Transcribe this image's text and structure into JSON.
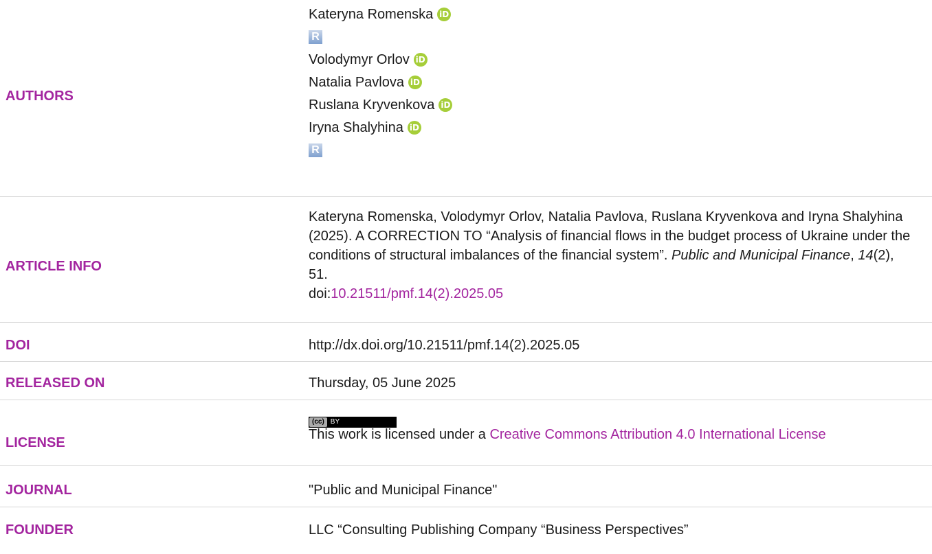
{
  "authors": {
    "label": "AUTHORS",
    "list": [
      {
        "name": "Kateryna Romenska",
        "orcid": true,
        "researchgate": true
      },
      {
        "name": "Volodymyr Orlov",
        "orcid": true,
        "researchgate": false
      },
      {
        "name": "Natalia Pavlova",
        "orcid": true,
        "researchgate": false
      },
      {
        "name": "Ruslana Kryvenkova",
        "orcid": true,
        "researchgate": false
      },
      {
        "name": "Iryna Shalyhina",
        "orcid": true,
        "researchgate": true
      }
    ],
    "orcid_text": "iD",
    "rg_text": "R"
  },
  "article_info": {
    "label": "ARTICLE INFO",
    "citation_prefix": "Kateryna Romenska, Volodymyr Orlov, Natalia Pavlova, Ruslana Kryvenkova and Iryna Shalyhina (2025). A CORRECTION TO “Analysis of financial flows in the budget process of Ukraine under the conditions of structural imbalances of the financial system”. ",
    "journal_italic": "Public and Municipal Finance",
    "comma": ", ",
    "volume_italic": "14",
    "issue_pages": "(2), 51.",
    "doi_prefix": "doi:",
    "doi_link": "10.21511/pmf.14(2).2025.05"
  },
  "doi": {
    "label": "DOI",
    "value": "http://dx.doi.org/10.21511/pmf.14(2).2025.05"
  },
  "released_on": {
    "label": "RELEASED ON",
    "value": "Thursday, 05 June 2025"
  },
  "license": {
    "label": "LICENSE",
    "badge_cc": "(cc)",
    "badge_by": "BY",
    "text": "This work is licensed under a ",
    "link_text": "Creative Commons Attribution 4.0 International License"
  },
  "journal": {
    "label": "JOURNAL",
    "value": "\"Public and Municipal Finance\""
  },
  "founder": {
    "label": "FOUNDER",
    "value": "LLC “Consulting Publishing Company “Business Perspectives”"
  },
  "colors": {
    "label": "#a3259f",
    "link": "#a3259f",
    "orcid": "#a6ce39",
    "divider": "#d6d6d6"
  }
}
